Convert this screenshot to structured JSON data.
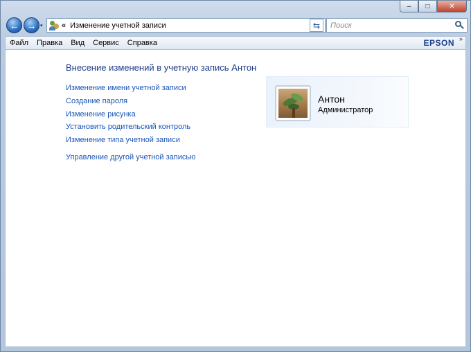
{
  "window": {
    "minimize_glyph": "–",
    "maximize_glyph": "□",
    "close_glyph": "✕"
  },
  "nav": {
    "back_glyph": "←",
    "forward_glyph": "→",
    "history_glyph": "▾"
  },
  "address": {
    "icon": "user-accounts-icon",
    "chevron": "«",
    "text": "Изменение учетной записи",
    "dropdown_glyph": "▾",
    "refresh_glyph": "⇆"
  },
  "search": {
    "placeholder": "Поиск"
  },
  "menubar": {
    "items": [
      "Файл",
      "Правка",
      "Вид",
      "Сервис",
      "Справка"
    ],
    "brand": "EPSON",
    "more": "»"
  },
  "content": {
    "heading": "Внесение изменений в учетную запись Антон",
    "tasks": [
      "Изменение имени учетной записи",
      "Создание пароля",
      "Изменение рисунка",
      "Установить родительский контроль",
      "Изменение типа учетной записи"
    ],
    "other_task": "Управление другой учетной записью"
  },
  "user": {
    "name": "Антон",
    "role": "Администратор"
  },
  "colors": {
    "link": "#1a55b8",
    "heading": "#1e3b8a",
    "brand": "#1a3f8c"
  }
}
